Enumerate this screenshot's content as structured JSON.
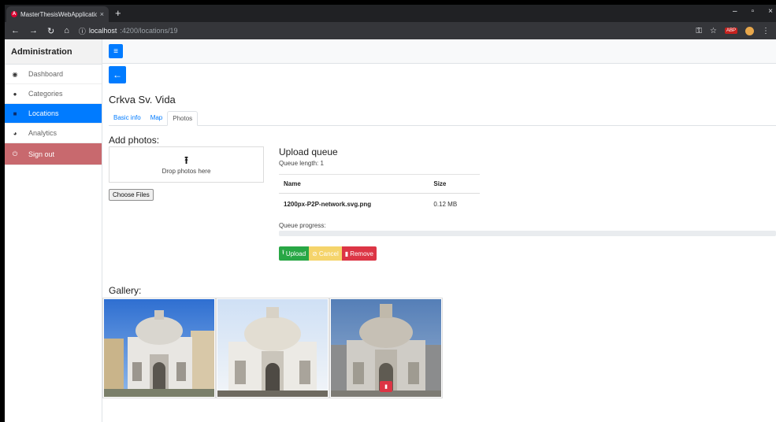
{
  "browser": {
    "tab_title": "MasterThesisWebApplicationFro",
    "tab_close": "×",
    "new_tab": "+",
    "url_host": "localhost",
    "url_path": ":4200/locations/19",
    "win_min": "–",
    "win_max": "▫",
    "win_close": "×",
    "ext_label": "ABP"
  },
  "sidebar": {
    "title": "Administration",
    "items": [
      {
        "label": "Dashboard",
        "icon": "tachometer-icon"
      },
      {
        "label": "Categories",
        "icon": "tag-icon"
      },
      {
        "label": "Locations",
        "icon": "map-icon"
      },
      {
        "label": "Analytics",
        "icon": "pie-chart-icon"
      },
      {
        "label": "Sign out",
        "icon": "power-icon"
      }
    ]
  },
  "page": {
    "title": "Crkva Sv. Vida",
    "tabs": [
      "Basic info",
      "Map",
      "Photos"
    ],
    "active_tab": "Photos"
  },
  "add_photos": {
    "heading": "Add photos:",
    "dropzone_text": "Drop photos here",
    "choose_files_label": "Choose Files"
  },
  "upload_queue": {
    "heading": "Upload queue",
    "queue_length": "Queue length: 1",
    "columns": [
      "Name",
      "Size"
    ],
    "rows": [
      {
        "name": "1200px-P2P-network.svg.png",
        "size": "0.12 MB"
      }
    ],
    "progress_label": "Queue progress:",
    "progress_fraction": 0,
    "buttons": {
      "upload": "Upload",
      "cancel": "Cancel",
      "remove": "Remove"
    }
  },
  "gallery": {
    "heading": "Gallery:",
    "items": 3
  },
  "colors": {
    "primary": "#007bff",
    "success": "#28a745",
    "warning": "#f5d46b",
    "danger": "#dc3545",
    "signout": "#c8696e"
  }
}
